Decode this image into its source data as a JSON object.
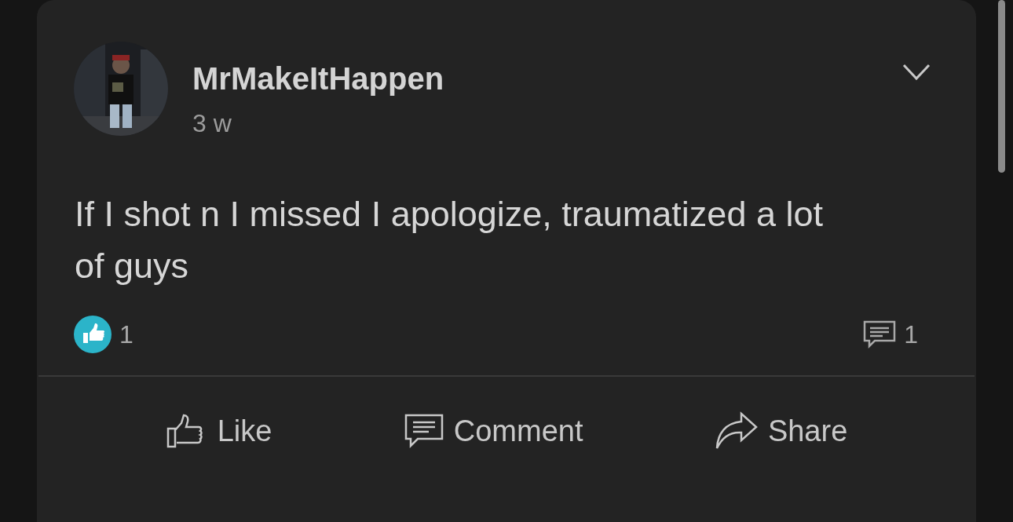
{
  "post": {
    "author": "MrMakeItHappen",
    "time": "3 w",
    "text": "If I shot n I missed I apologize, traumatized a lot of guys",
    "reactions": {
      "likes": "1",
      "comments": "1"
    },
    "actions": [
      {
        "kind": "like",
        "label": "Like"
      },
      {
        "kind": "comment",
        "label": "Comment"
      },
      {
        "kind": "share",
        "label": "Share"
      }
    ]
  }
}
